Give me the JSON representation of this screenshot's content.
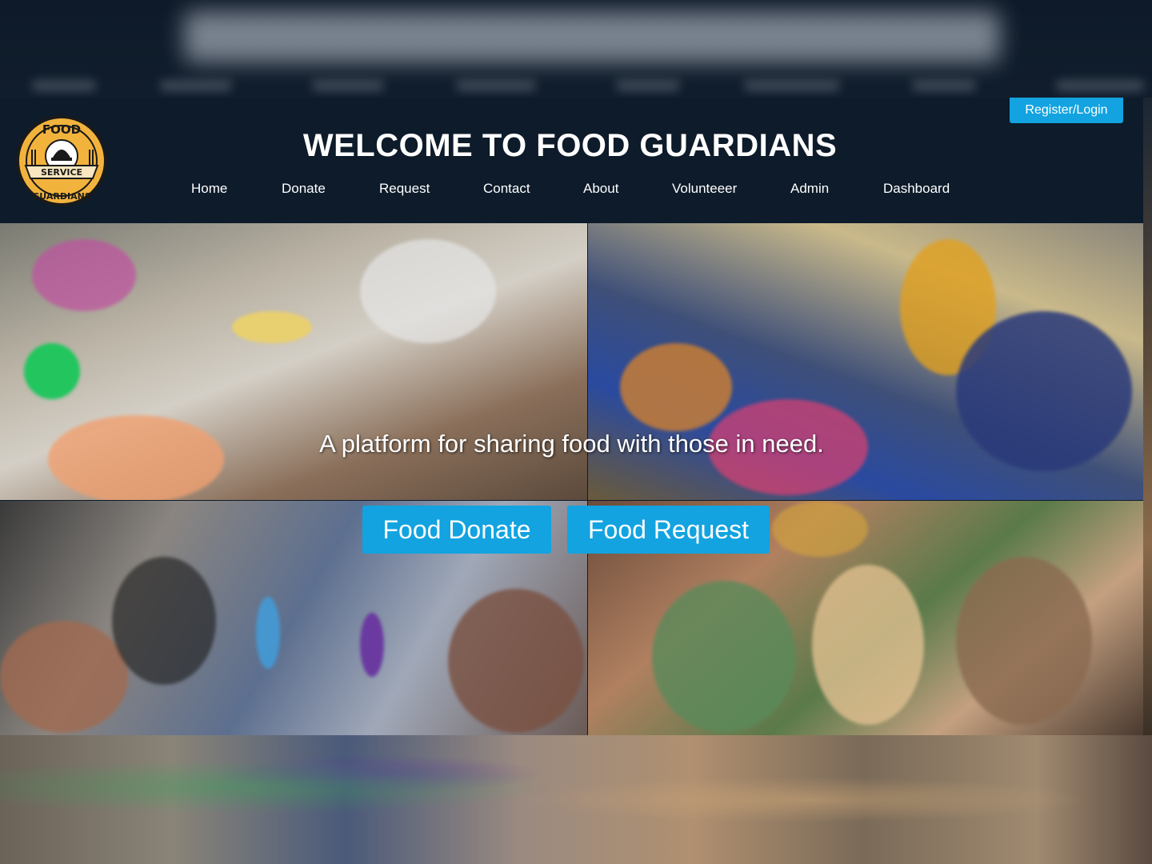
{
  "header": {
    "title": "WELCOME TO FOOD GUARDIANS",
    "register_label": "Register/Login",
    "logo": {
      "icon": "food-guardians-logo",
      "top_text": "FOOD",
      "banner_text": "SERVICE",
      "bottom_text": "GUARDIANS"
    }
  },
  "nav": {
    "items": [
      {
        "label": "Home"
      },
      {
        "label": "Donate"
      },
      {
        "label": "Request"
      },
      {
        "label": "Contact"
      },
      {
        "label": "About"
      },
      {
        "label": "Volunteeer"
      },
      {
        "label": "Admin"
      },
      {
        "label": "Dashboard"
      }
    ]
  },
  "hero": {
    "tagline": "A platform for sharing food with those in need.",
    "donate_label": "Food Donate",
    "request_label": "Food Request"
  },
  "colors": {
    "header_bg": "#0d1b2a",
    "accent": "#12a3e0",
    "logo_gold": "#f2b33d"
  }
}
